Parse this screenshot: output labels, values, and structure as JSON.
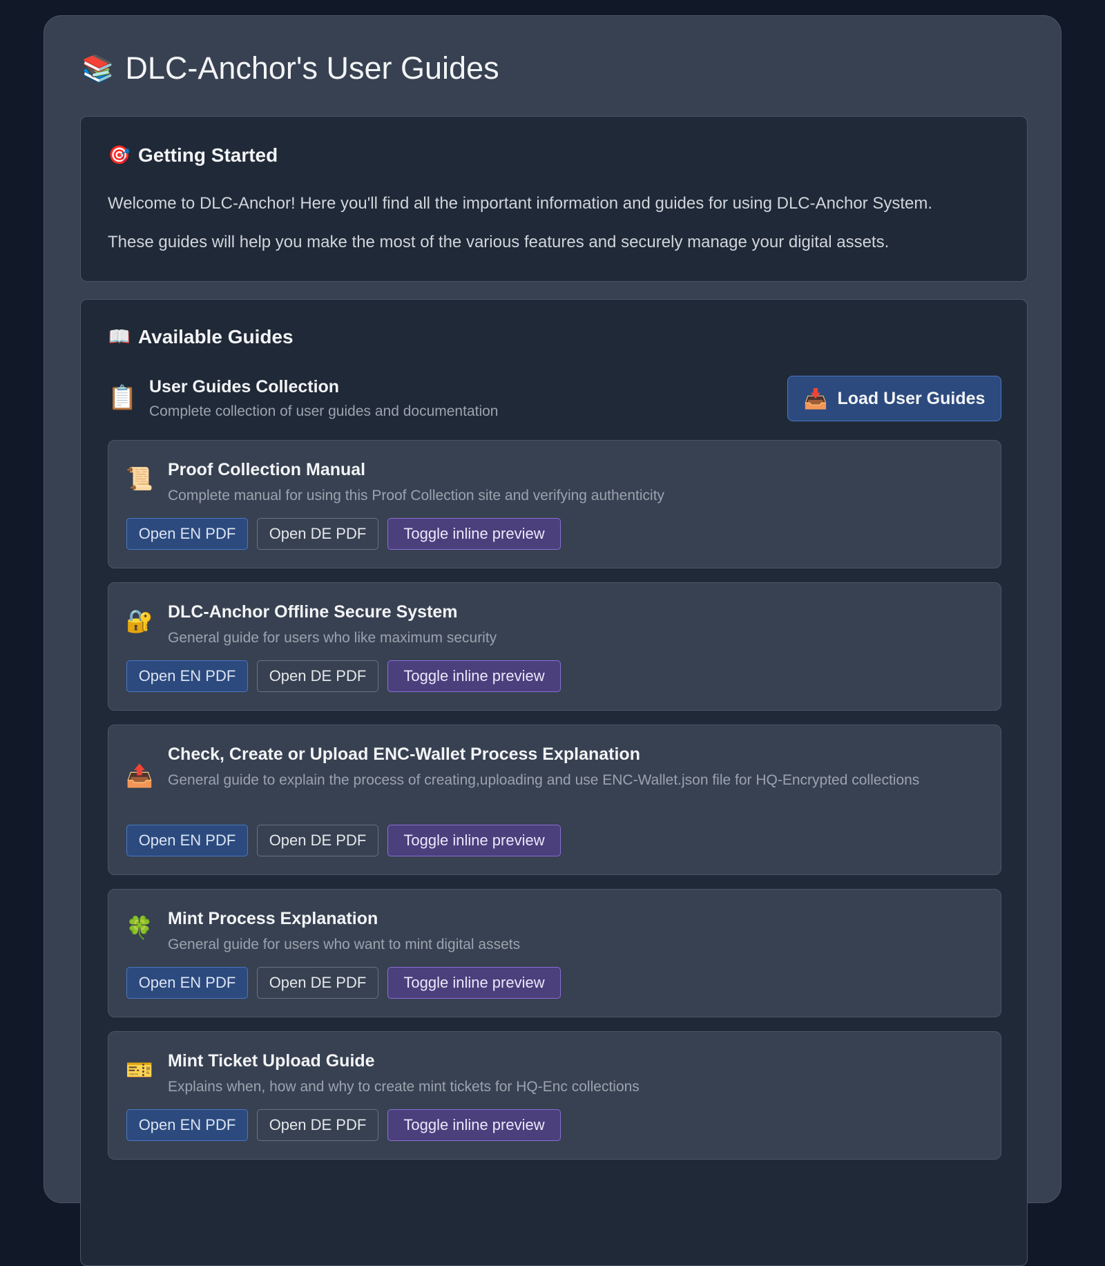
{
  "page": {
    "title_icon": "books-icon",
    "title_emoji": "📚",
    "title": "DLC-Anchor's User Guides"
  },
  "getting_started": {
    "icon": "dart-target-icon",
    "emoji": "🎯",
    "heading": "Getting Started",
    "paragraphs": [
      "Welcome to DLC-Anchor! Here you'll find all the important information and guides for using DLC-Anchor System.",
      "These guides will help you make the most of the various features and securely manage your digital assets."
    ]
  },
  "available_guides": {
    "icon": "open-book-icon",
    "emoji": "📖",
    "heading": "Available Guides",
    "collection": {
      "icon": "clipboard-icon",
      "emoji": "📋",
      "title": "User Guides Collection",
      "description": "Complete collection of user guides and documentation",
      "load_button": {
        "icon": "inbox-tray-icon",
        "emoji": "📥",
        "label": "Load User Guides"
      }
    },
    "guides": [
      {
        "icon": "scroll-icon",
        "emoji": "📜",
        "title": "Proof Collection Manual",
        "description": "Complete manual for using this Proof Collection site and verifying authenticity",
        "en_label": "Open EN PDF",
        "de_label": "Open DE PDF",
        "preview_label": "Toggle inline preview"
      },
      {
        "icon": "lock-with-key-icon",
        "emoji": "🔐",
        "title": "DLC-Anchor Offline Secure System",
        "description": "General guide for users who like maximum security",
        "en_label": "Open EN PDF",
        "de_label": "Open DE PDF",
        "preview_label": "Toggle inline preview"
      },
      {
        "icon": "outbox-tray-icon",
        "emoji": "📤",
        "title": "Check, Create or Upload ENC-Wallet Process Explanation",
        "description": "General guide to explain the process of creating,uploading and use ENC-Wallet.json file for HQ-Encrypted collections",
        "en_label": "Open EN PDF",
        "de_label": "Open DE PDF",
        "preview_label": "Toggle inline preview"
      },
      {
        "icon": "four-leaf-clover-icon",
        "emoji": "🍀",
        "title": "Mint Process Explanation",
        "description": "General guide for users who want to mint digital assets",
        "en_label": "Open EN PDF",
        "de_label": "Open DE PDF",
        "preview_label": "Toggle inline preview"
      },
      {
        "icon": "ticket-icon",
        "emoji": "🎫",
        "title": "Mint Ticket Upload Guide",
        "description": "Explains when, how and why to create mint tickets for HQ-Enc collections",
        "en_label": "Open EN PDF",
        "de_label": "Open DE PDF",
        "preview_label": "Toggle inline preview"
      }
    ]
  },
  "colors": {
    "background": "#111827",
    "panel": "#374151",
    "card": "#1f2937",
    "primary_button": "#2c4a7e",
    "preview_button": "#4b3f7c"
  }
}
